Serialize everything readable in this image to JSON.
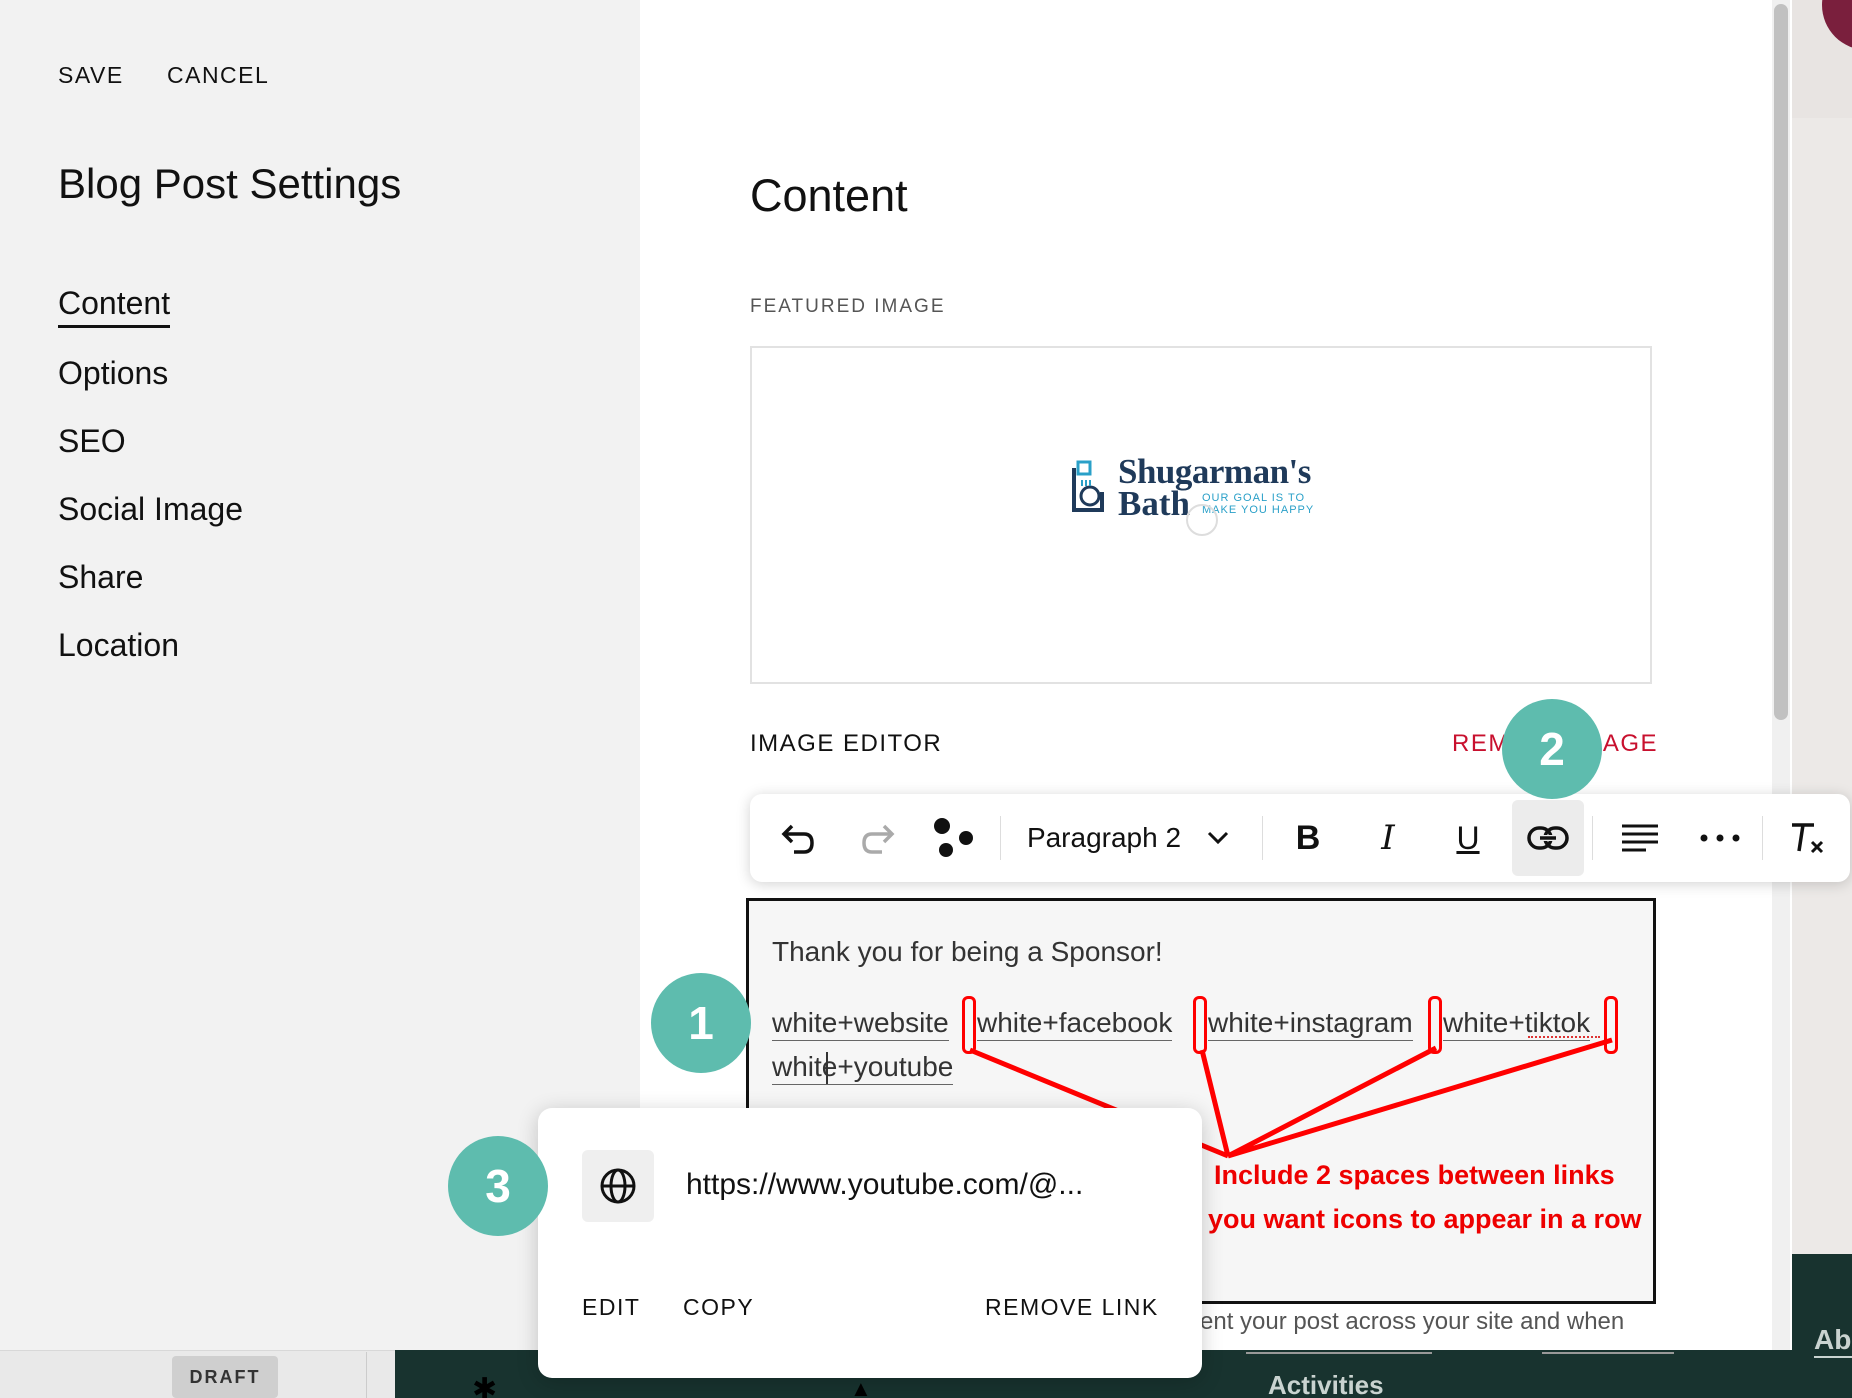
{
  "header": {
    "save_label": "SAVE",
    "cancel_label": "CANCEL",
    "title": "Blog Post Settings"
  },
  "nav": {
    "items": [
      {
        "label": "Content",
        "active": true
      },
      {
        "label": "Options"
      },
      {
        "label": "SEO"
      },
      {
        "label": "Social Image"
      },
      {
        "label": "Share"
      },
      {
        "label": "Location"
      }
    ]
  },
  "content": {
    "title": "Content",
    "featured_image_label": "FEATURED IMAGE",
    "logo": {
      "name_line1": "Shugarman's",
      "name_line2": "Bath",
      "tagline_line1": "OUR GOAL IS TO",
      "tagline_line2": "MAKE YOU HAPPY"
    },
    "image_editor_label": "IMAGE EDITOR",
    "remove_image_label": "REMOVE IMAGE"
  },
  "toolbar": {
    "paragraph_style": "Paragraph 2",
    "icons": [
      "undo-icon",
      "redo-icon",
      "blocks-icon",
      "chevron-down-icon",
      "bold-icon",
      "italic-icon",
      "underline-icon",
      "link-icon",
      "align-icon",
      "more-icon",
      "clear-format-icon"
    ],
    "bold_glyph": "B",
    "italic_glyph": "I",
    "underline_glyph": "U"
  },
  "editor": {
    "line1": "Thank you for being a Sponsor!",
    "links": [
      "white+website",
      "white+facebook",
      "white+instagram",
      "white+tiktok",
      "white+youtube"
    ],
    "below_text": "ent your post across your site and when"
  },
  "annotation": {
    "line1": "Include 2 spaces between links",
    "line2": "if you want icons to appear in a row",
    "color": "#ff0000"
  },
  "steps": [
    "1",
    "2",
    "3"
  ],
  "popup": {
    "url": "https://www.youtube.com/@...",
    "edit_label": "EDIT",
    "copy_label": "COPY",
    "remove_label": "REMOVE LINK"
  },
  "status": {
    "draft_label": "DRAFT"
  },
  "site": {
    "footer_activities": "Activities",
    "footer_ab": "Ab"
  },
  "colors": {
    "accent_teal": "#5ebcae",
    "danger_red": "#c8102e",
    "footer_green": "#18332f"
  }
}
